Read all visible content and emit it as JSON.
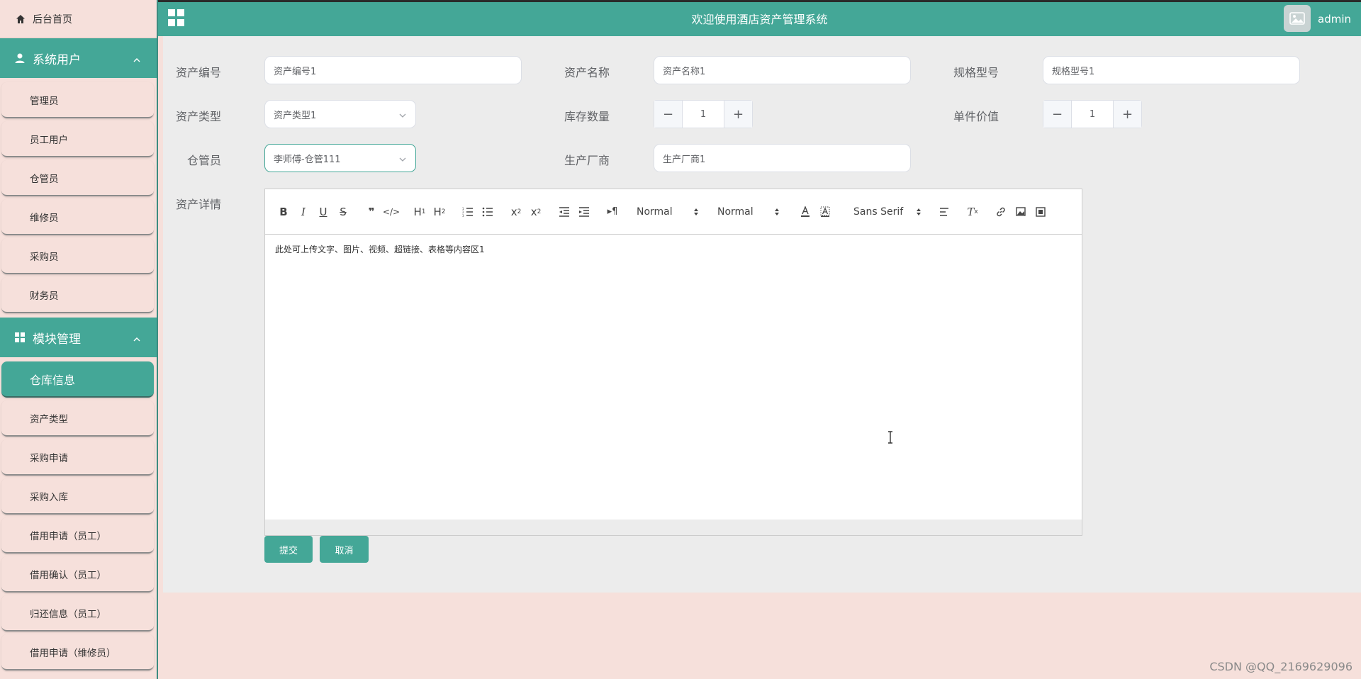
{
  "app": {
    "title": "欢迎使用酒店资产管理系统",
    "username": "admin",
    "colors": {
      "primary": "#44a797",
      "background": "#f6e0db",
      "panel": "#ececec"
    }
  },
  "sidebar": {
    "home_label": "后台首页",
    "groups": [
      {
        "title": "系统用户",
        "icon": "user-icon",
        "items": [
          "管理员",
          "员工用户",
          "仓管员",
          "维修员",
          "采购员",
          "财务员"
        ]
      },
      {
        "title": "模块管理",
        "icon": "grid-icon",
        "items": [
          "仓库信息",
          "资产类型",
          "采购申请",
          "采购入库",
          "借用申请（员工）",
          "借用确认（员工）",
          "归还信息（员工）",
          "借用申请（维修员）"
        ],
        "active": "仓库信息"
      }
    ]
  },
  "form": {
    "asset_code": {
      "label": "资产编号",
      "value": "资产编号1"
    },
    "asset_name": {
      "label": "资产名称",
      "value": "资产名称1"
    },
    "spec_model": {
      "label": "规格型号",
      "value": "规格型号1"
    },
    "asset_type": {
      "label": "资产类型",
      "value": "资产类型1"
    },
    "stock_qty": {
      "label": "库存数量",
      "value": "1"
    },
    "unit_value": {
      "label": "单件价值",
      "value": "1"
    },
    "keeper": {
      "label": "仓管员",
      "value": "李师傅-仓管111"
    },
    "manufacturer": {
      "label": "生产厂商",
      "value": "生产厂商1"
    },
    "details": {
      "label": "资产详情",
      "content": "此处可上传文字、图片、视频、超链接、表格等内容区1",
      "toolbar": {
        "header_select": "Normal",
        "size_select": "Normal",
        "font_select": "Sans Serif"
      }
    },
    "submit_label": "提交",
    "cancel_label": "取消"
  },
  "watermark": "CSDN @QQ_2169629096"
}
